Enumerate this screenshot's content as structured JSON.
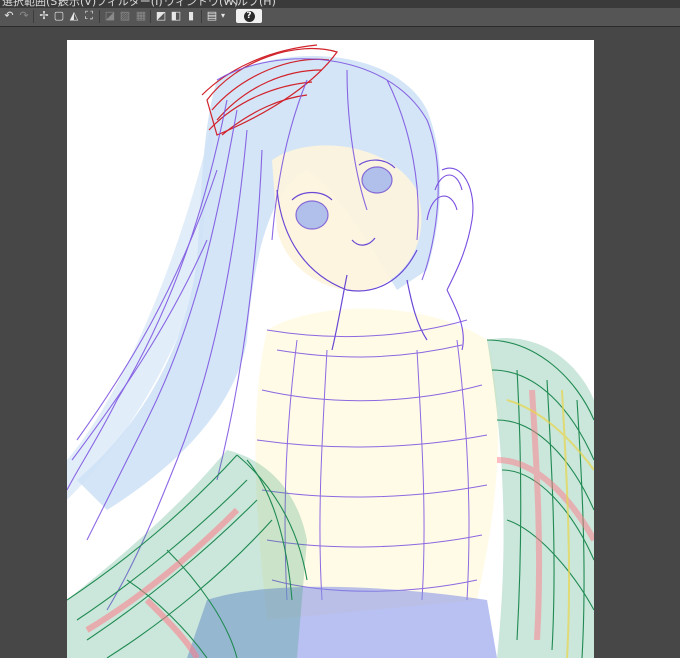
{
  "menu": {
    "items": [
      {
        "label": "選択範囲(S)"
      },
      {
        "label": "表示(V)"
      },
      {
        "label": "フィルター(I)"
      },
      {
        "label": "ウィンドウ(W)"
      },
      {
        "label": "ヘルプ(H)"
      }
    ]
  },
  "toolbar": {
    "icons": [
      "undo-icon",
      "redo-icon",
      "selection-icon",
      "deselect-icon",
      "fill-icon",
      "transform-icon",
      "ruler-icon",
      "snap-icon",
      "grid-icon",
      "perspective-icon",
      "symmetry-icon",
      "pen-pressure-icon",
      "window-layout-icon"
    ],
    "help_label": "?"
  },
  "colors": {
    "app_bg": "#474747",
    "toolbar_bg": "#555555",
    "canvas_bg": "#ffffff",
    "sketch_purple": "#7a4fe0",
    "sketch_blue": "#a9c8f0",
    "hat_red": "#d1232b",
    "shawl_green": "#1f8a52",
    "skin": "#fff7dc"
  }
}
